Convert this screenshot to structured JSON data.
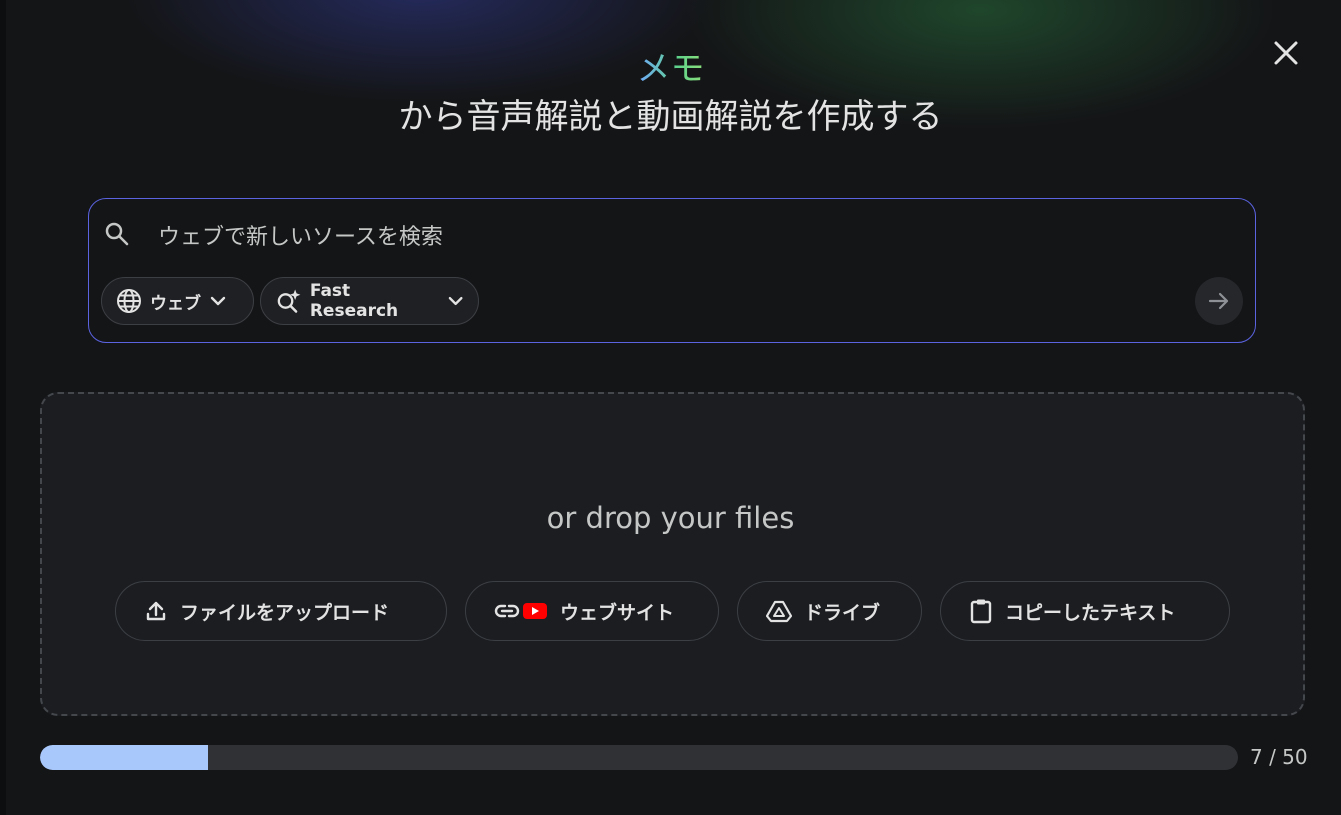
{
  "dialog": {
    "close_icon": "close-icon",
    "title_accent": "メモ",
    "title_main": "から音声解説と動画解説を作成する"
  },
  "search": {
    "placeholder": "ウェブで新しいソースを検索",
    "value": "",
    "icon": "search-icon",
    "source_chip": {
      "label": "ウェブ",
      "icon": "globe-icon"
    },
    "mode_chip": {
      "label": "Fast Research",
      "icon": "sparkle-search-icon"
    },
    "submit_icon": "arrow-right-icon"
  },
  "drop_zone": {
    "text": "or drop your files",
    "buttons": [
      {
        "label": "ファイルをアップロード",
        "icon": "upload-icon"
      },
      {
        "label": "ウェブサイト",
        "icon": "link-youtube-icon"
      },
      {
        "label": "ドライブ",
        "icon": "drive-icon"
      },
      {
        "label": "コピーしたテキスト",
        "icon": "clipboard-icon"
      }
    ]
  },
  "progress": {
    "current": 7,
    "max": 50,
    "label": "7 / 50"
  },
  "colors": {
    "accent_border": "#5b63e0",
    "progress_fill": "#a8c7fa",
    "youtube_red": "#ff0000"
  }
}
